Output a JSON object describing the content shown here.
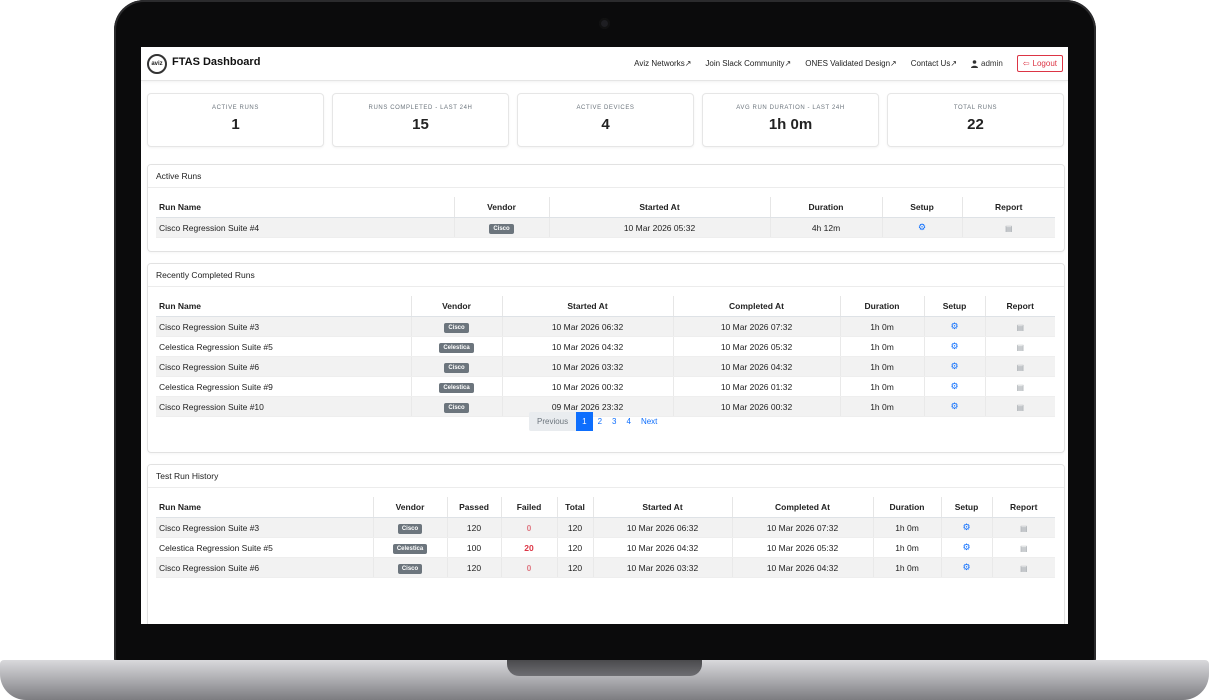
{
  "header": {
    "logo_text": "aviz",
    "title": "FTAS Dashboard",
    "nav": [
      {
        "label": "Aviz Networks↗"
      },
      {
        "label": "Join Slack Community↗"
      },
      {
        "label": "ONES Validated Design↗"
      },
      {
        "label": "Contact Us↗"
      }
    ],
    "user": "admin",
    "logout": "Logout"
  },
  "stats": [
    {
      "label": "Active Runs",
      "value": "1"
    },
    {
      "label": "Runs Completed - Last 24h",
      "value": "15"
    },
    {
      "label": "Active Devices",
      "value": "4"
    },
    {
      "label": "Avg Run Duration - Last 24h",
      "value": "1h 0m"
    },
    {
      "label": "Total Runs",
      "value": "22"
    }
  ],
  "active_runs": {
    "title": "Active Runs",
    "columns": [
      "Run Name",
      "Vendor",
      "Started At",
      "Duration",
      "Setup",
      "Report"
    ],
    "rows": [
      {
        "name": "Cisco Regression Suite #4",
        "vendor": "Cisco",
        "started": "10 Mar 2026 05:32",
        "duration": "4h 12m"
      }
    ]
  },
  "completed_runs": {
    "title": "Recently Completed Runs",
    "columns": [
      "Run Name",
      "Vendor",
      "Started At",
      "Completed At",
      "Duration",
      "Setup",
      "Report"
    ],
    "rows": [
      {
        "name": "Cisco Regression Suite #3",
        "vendor": "Cisco",
        "started": "10 Mar 2026 06:32",
        "completed": "10 Mar 2026 07:32",
        "duration": "1h 0m"
      },
      {
        "name": "Celestica Regression Suite #5",
        "vendor": "Celestica",
        "started": "10 Mar 2026 04:32",
        "completed": "10 Mar 2026 05:32",
        "duration": "1h 0m"
      },
      {
        "name": "Cisco Regression Suite #6",
        "vendor": "Cisco",
        "started": "10 Mar 2026 03:32",
        "completed": "10 Mar 2026 04:32",
        "duration": "1h 0m"
      },
      {
        "name": "Celestica Regression Suite #9",
        "vendor": "Celestica",
        "started": "10 Mar 2026 00:32",
        "completed": "10 Mar 2026 01:32",
        "duration": "1h 0m"
      },
      {
        "name": "Cisco Regression Suite #10",
        "vendor": "Cisco",
        "started": "09 Mar 2026 23:32",
        "completed": "10 Mar 2026 00:32",
        "duration": "1h 0m"
      }
    ],
    "pagination": {
      "previous": "Previous",
      "pages": [
        "1",
        "2",
        "3",
        "4"
      ],
      "current": "1",
      "next": "Next"
    }
  },
  "history": {
    "title": "Test Run History",
    "columns": [
      "Run Name",
      "Vendor",
      "Passed",
      "Failed",
      "Total",
      "Started At",
      "Completed At",
      "Duration",
      "Setup",
      "Report"
    ],
    "rows": [
      {
        "name": "Cisco Regression Suite #3",
        "vendor": "Cisco",
        "passed": "120",
        "failed": "0",
        "total": "120",
        "started": "10 Mar 2026 06:32",
        "completed": "10 Mar 2026 07:32",
        "duration": "1h 0m"
      },
      {
        "name": "Celestica Regression Suite #5",
        "vendor": "Celestica",
        "passed": "100",
        "failed": "20",
        "total": "120",
        "started": "10 Mar 2026 04:32",
        "completed": "10 Mar 2026 05:32",
        "duration": "1h 0m"
      },
      {
        "name": "Cisco Regression Suite #6",
        "vendor": "Cisco",
        "passed": "120",
        "failed": "0",
        "total": "120",
        "started": "10 Mar 2026 03:32",
        "completed": "10 Mar 2026 04:32",
        "duration": "1h 0m"
      }
    ]
  },
  "icons": {
    "setup": "gear-icon",
    "report": "document-icon",
    "user": "user-icon",
    "logout": "logout-icon",
    "external": "external-link-icon"
  },
  "colors": {
    "accent": "#0d6efd",
    "danger": "#dc3545",
    "badge": "#6c757d"
  }
}
